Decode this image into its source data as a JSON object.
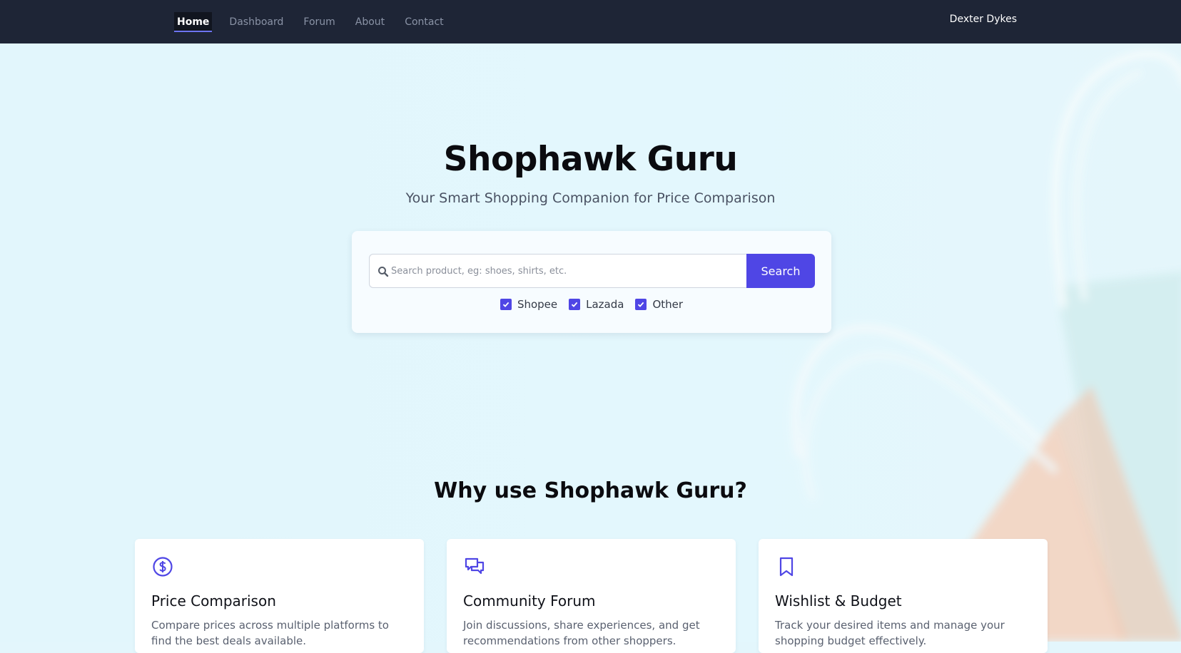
{
  "nav": {
    "links": [
      "Home",
      "Dashboard",
      "Forum",
      "About",
      "Contact"
    ],
    "active": "Home",
    "user": "Dexter Dykes"
  },
  "hero": {
    "title": "Shophawk Guru",
    "subtitle": "Your Smart Shopping Companion for Price Comparison"
  },
  "search": {
    "placeholder": "Search product, eg: shoes, shirts, etc.",
    "value": "",
    "button_label": "Search",
    "filters": [
      {
        "label": "Shopee",
        "checked": true
      },
      {
        "label": "Lazada",
        "checked": true
      },
      {
        "label": "Other",
        "checked": true
      }
    ]
  },
  "features": {
    "heading": "Why use Shophawk Guru?",
    "items": [
      {
        "icon": "dollar-circle-icon",
        "title": "Price Comparison",
        "description": "Compare prices across multiple platforms to find the best deals available."
      },
      {
        "icon": "chat-bubbles-icon",
        "title": "Community Forum",
        "description": "Join discussions, share experiences, and get recommendations from other shoppers."
      },
      {
        "icon": "bookmark-icon",
        "title": "Wishlist & Budget",
        "description": "Track your desired items and manage your shopping budget effectively."
      }
    ]
  },
  "colors": {
    "navbar": "#1e2536",
    "accent": "#4f46e5",
    "hero_bg": "#e3f6fc"
  }
}
